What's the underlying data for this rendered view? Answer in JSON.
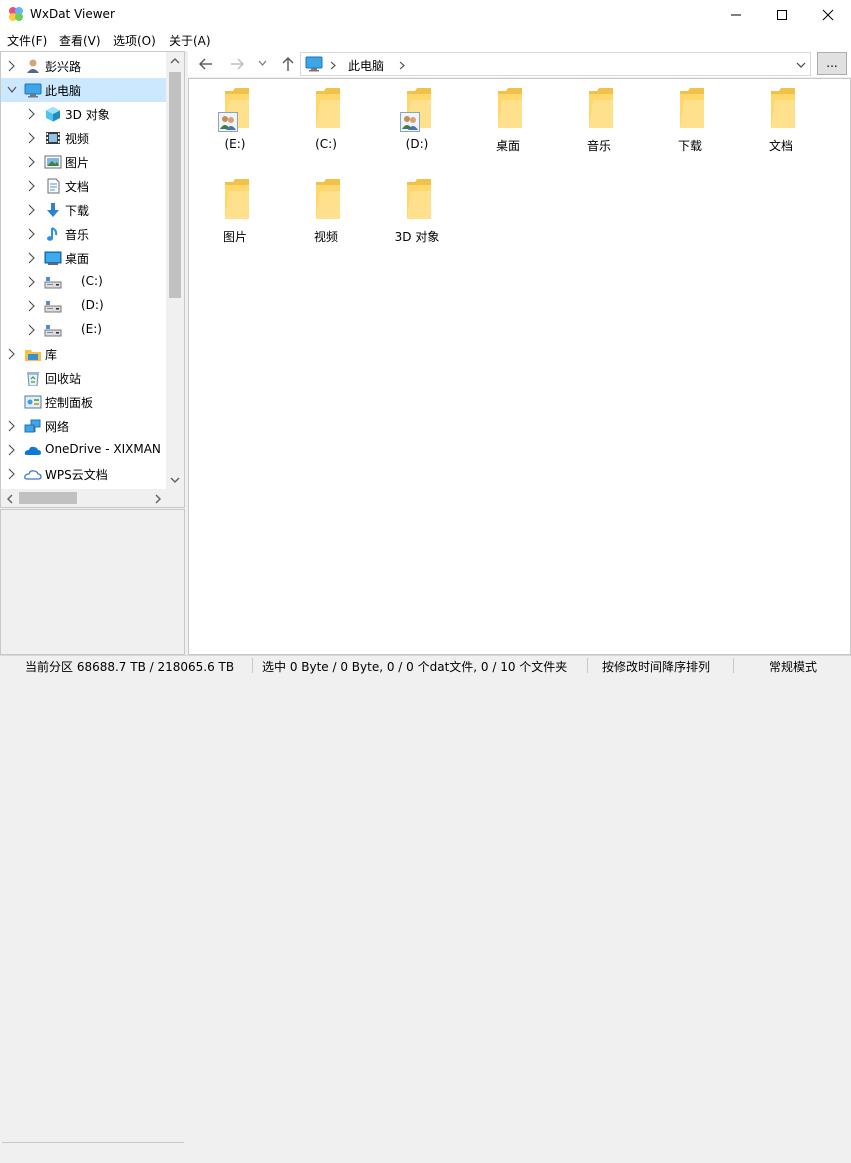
{
  "window": {
    "title": "WxDat Viewer"
  },
  "menu": [
    {
      "label": "文件(F)"
    },
    {
      "label": "查看(V)"
    },
    {
      "label": "选项(O)"
    },
    {
      "label": "关于(A)"
    }
  ],
  "tree": [
    {
      "label": "彭兴路",
      "icon": "user-icon"
    },
    {
      "label": "此电脑",
      "icon": "computer-icon"
    },
    {
      "label": "3D 对象",
      "icon": "3d-objects-icon"
    },
    {
      "label": "视频",
      "icon": "video-icon"
    },
    {
      "label": "图片",
      "icon": "pictures-icon"
    },
    {
      "label": "文档",
      "icon": "documents-icon"
    },
    {
      "label": "下载",
      "icon": "download-icon"
    },
    {
      "label": "音乐",
      "icon": "music-icon"
    },
    {
      "label": "桌面",
      "icon": "desktop-icon"
    },
    {
      "label": "(C:)",
      "icon": "drive-icon"
    },
    {
      "label": "(D:)",
      "icon": "drive-icon"
    },
    {
      "label": "(E:)",
      "icon": "drive-icon"
    },
    {
      "label": "库",
      "icon": "library-icon"
    },
    {
      "label": "回收站",
      "icon": "recycle-bin-icon"
    },
    {
      "label": "控制面板",
      "icon": "control-panel-icon"
    },
    {
      "label": "网络",
      "icon": "network-icon"
    },
    {
      "label": "OneDrive - XIXMAN",
      "icon": "onedrive-icon"
    },
    {
      "label": "WPS云文档",
      "icon": "cloud-icon"
    }
  ],
  "address": {
    "segments": [
      "此电脑"
    ],
    "more_label": "..."
  },
  "items": [
    {
      "label": "(E:)",
      "shared": true
    },
    {
      "label": "(C:)",
      "shared": false
    },
    {
      "label": "(D:)",
      "shared": true
    },
    {
      "label": "桌面",
      "shared": false
    },
    {
      "label": "音乐",
      "shared": false
    },
    {
      "label": "下载",
      "shared": false
    },
    {
      "label": "文档",
      "shared": false
    },
    {
      "label": "图片",
      "shared": false
    },
    {
      "label": "视频",
      "shared": false
    },
    {
      "label": "3D 对象",
      "shared": false
    }
  ],
  "status": {
    "partition": "当前分区 68688.7 TB / 218065.6 TB",
    "selection": "选中 0 Byte / 0 Byte,  0 / 0 个dat文件,  0 / 10 个文件夹",
    "sort": "按修改时间降序排列",
    "mode": "常规模式"
  },
  "colors": {
    "folder": "#ffd76b",
    "folder_dark": "#f0c24a",
    "selection": "#cce8ff",
    "accent": "#0078d7"
  }
}
